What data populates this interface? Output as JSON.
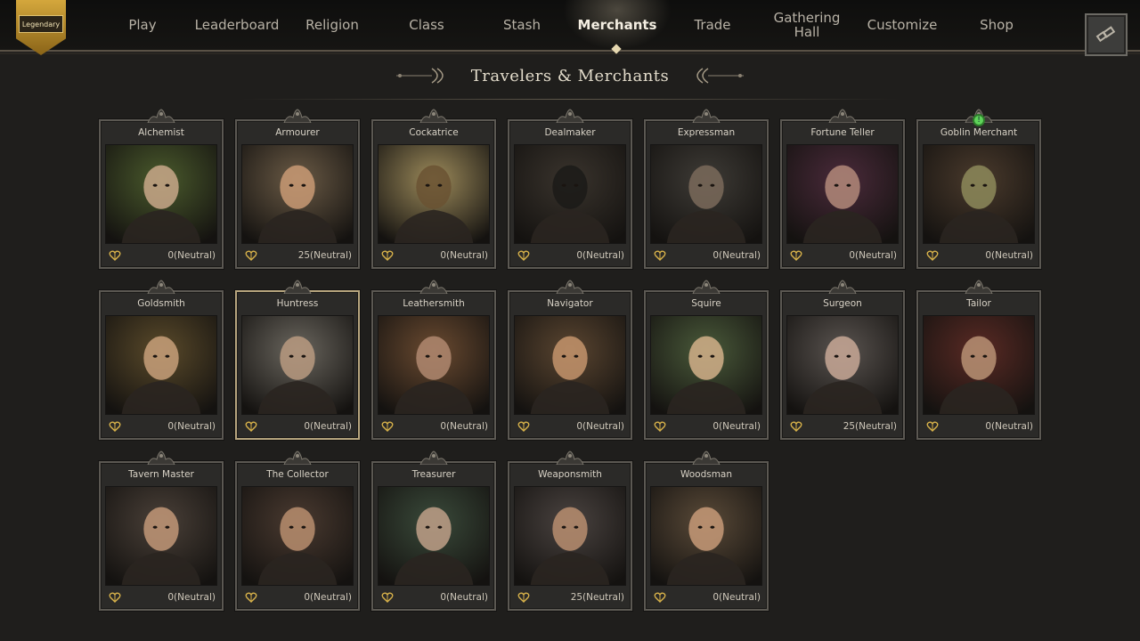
{
  "rank_badge": {
    "label": "Legendary"
  },
  "nav": {
    "items": [
      "Play",
      "Leaderboard",
      "Religion",
      "Class",
      "Stash",
      "Merchants",
      "Trade",
      "Gathering\nHall",
      "Customize",
      "Shop"
    ],
    "active": "Merchants"
  },
  "page": {
    "title": "Travelers & Merchants"
  },
  "colors": {
    "accent": "#d8b24a",
    "alert": "#5fd35a",
    "text": "#d8d2c6"
  },
  "merchants": [
    {
      "name": "Alchemist",
      "reputation": "0(Neutral)",
      "tone": "#4a5a2c",
      "skin": "#c9a88a"
    },
    {
      "name": "Armourer",
      "reputation": "25(Neutral)",
      "tone": "#6a5a45",
      "skin": "#c99a74"
    },
    {
      "name": "Cockatrice",
      "reputation": "0(Neutral)",
      "tone": "#9c8a5a",
      "skin": "#6a5233"
    },
    {
      "name": "Dealmaker",
      "reputation": "0(Neutral)",
      "tone": "#3a342d",
      "skin": "#1b1a18"
    },
    {
      "name": "Expressman",
      "reputation": "0(Neutral)",
      "tone": "#3e3b36",
      "skin": "#7a6a5a"
    },
    {
      "name": "Fortune Teller",
      "reputation": "0(Neutral)",
      "tone": "#4a2a3a",
      "skin": "#b38a7a"
    },
    {
      "name": "Goblin Merchant",
      "reputation": "0(Neutral)",
      "tone": "#4a3a2c",
      "skin": "#8d8a5a",
      "alert": true
    },
    {
      "name": "Goldsmith",
      "reputation": "0(Neutral)",
      "tone": "#5a4a2a",
      "skin": "#c8a07a"
    },
    {
      "name": "Huntress",
      "reputation": "0(Neutral)",
      "tone": "#6a665e",
      "skin": "#b99a80",
      "highlight": true
    },
    {
      "name": "Leathersmith",
      "reputation": "0(Neutral)",
      "tone": "#6a4a30",
      "skin": "#b08870"
    },
    {
      "name": "Navigator",
      "reputation": "0(Neutral)",
      "tone": "#5a4530",
      "skin": "#c4946c"
    },
    {
      "name": "Squire",
      "reputation": "0(Neutral)",
      "tone": "#4a5a3a",
      "skin": "#d2b08a"
    },
    {
      "name": "Surgeon",
      "reputation": "25(Neutral)",
      "tone": "#5a5450",
      "skin": "#c8a896"
    },
    {
      "name": "Tailor",
      "reputation": "0(Neutral)",
      "tone": "#5a2a24",
      "skin": "#b99274"
    },
    {
      "name": "Tavern Master",
      "reputation": "0(Neutral)",
      "tone": "#4a4038",
      "skin": "#c29878"
    },
    {
      "name": "The Collector",
      "reputation": "0(Neutral)",
      "tone": "#4a3a30",
      "skin": "#b88e6e"
    },
    {
      "name": "Treasurer",
      "reputation": "0(Neutral)",
      "tone": "#3a4a3a",
      "skin": "#c0a088"
    },
    {
      "name": "Weaponsmith",
      "reputation": "25(Neutral)",
      "tone": "#4a4340",
      "skin": "#b98e70"
    },
    {
      "name": "Woodsman",
      "reputation": "0(Neutral)",
      "tone": "#5a4a38",
      "skin": "#c79a78"
    }
  ],
  "icons": {
    "settings": "spyglass-icon",
    "reputation": "heart-icon",
    "alert": "exclamation-icon"
  }
}
